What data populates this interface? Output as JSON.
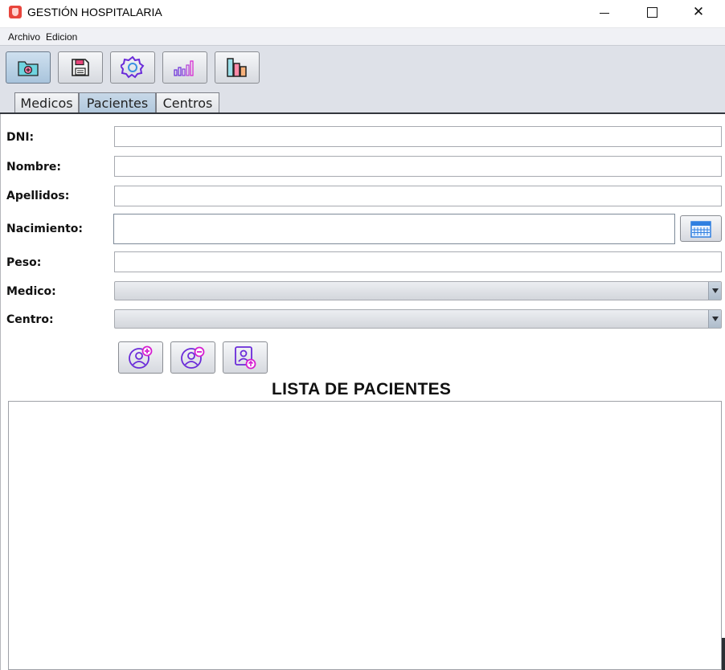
{
  "window": {
    "title": "GESTIÓN HOSPITALARIA",
    "close_glyph": "✕"
  },
  "menu": {
    "items": [
      {
        "label": "Archivo"
      },
      {
        "label": "Edicion"
      }
    ]
  },
  "toolbar": {
    "buttons": [
      {
        "icon": "folder-add-icon",
        "active": true
      },
      {
        "icon": "save-icon",
        "active": false
      },
      {
        "icon": "settings-gear-icon",
        "active": false
      },
      {
        "icon": "bar-chart-icon",
        "active": false
      },
      {
        "icon": "column-chart-icon",
        "active": false
      }
    ]
  },
  "tabs": [
    {
      "label": "Medicos",
      "selected": false
    },
    {
      "label": "Pacientes",
      "selected": true
    },
    {
      "label": "Centros",
      "selected": false
    }
  ],
  "form": {
    "dni": {
      "label": "DNI:",
      "value": ""
    },
    "nombre": {
      "label": "Nombre:",
      "value": ""
    },
    "apellidos": {
      "label": "Apellidos:",
      "value": ""
    },
    "nacimiento": {
      "label": "Nacimiento:",
      "value": ""
    },
    "peso": {
      "label": "Peso:",
      "value": ""
    },
    "medico": {
      "label": "Medico:",
      "selected": ""
    },
    "centro": {
      "label": "Centro:",
      "selected": ""
    }
  },
  "actions": [
    {
      "icon": "add-user-icon"
    },
    {
      "icon": "remove-user-icon"
    },
    {
      "icon": "update-user-icon"
    }
  ],
  "list": {
    "title": "LISTA DE PACIENTES",
    "items": []
  },
  "colors": {
    "toolbar_bg": "#dee1e8",
    "icon_purple": "#6a2bd9",
    "icon_magenta": "#d61fd0",
    "icon_teal": "#3fb6c8",
    "icon_pink": "#e8457a",
    "icon_orange": "#f39a63"
  }
}
